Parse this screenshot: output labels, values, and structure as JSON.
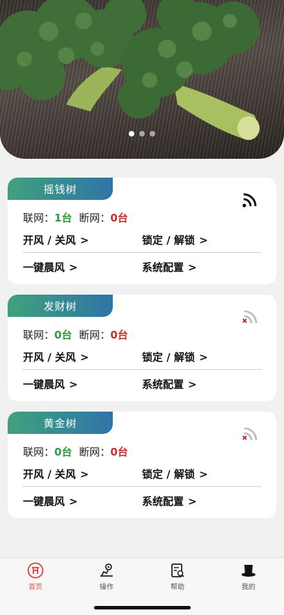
{
  "banner": {
    "image": "broccoli-photo",
    "slides": 3,
    "active_slide": 0
  },
  "devices": [
    {
      "name": "摇钱树",
      "connected": true,
      "online_label": "联网：",
      "online_count": "1台",
      "offline_label": "断网：",
      "offline_count": "0台",
      "actions": [
        "开风 / 关风",
        "锁定 / 解锁",
        "一键晨风",
        "系统配置"
      ]
    },
    {
      "name": "发财树",
      "connected": false,
      "online_label": "联网：",
      "online_count": "0台",
      "offline_label": "断网：",
      "offline_count": "0台",
      "actions": [
        "开风 / 关风",
        "锁定 / 解锁",
        "一键晨风",
        "系统配置"
      ]
    },
    {
      "name": "黄金树",
      "connected": false,
      "online_label": "联网：",
      "online_count": "0台",
      "offline_label": "断网：",
      "offline_count": "0台",
      "actions": [
        "开风 / 关风",
        "锁定 / 解锁",
        "一键晨风",
        "系统配置"
      ]
    }
  ],
  "chevron": ">",
  "tabbar": {
    "tabs": [
      {
        "label": "首页",
        "icon": "home-icon",
        "active": true
      },
      {
        "label": "操作",
        "icon": "operation-icon",
        "active": false
      },
      {
        "label": "帮助",
        "icon": "help-icon",
        "active": false
      },
      {
        "label": "我的",
        "icon": "profile-icon",
        "active": false
      }
    ]
  },
  "colors": {
    "title_gradient_start": "#3fa27b",
    "title_gradient_end": "#2f74a8",
    "online": "#2f9a3e",
    "offline": "#c9302c",
    "active_tab": "#d9534f"
  }
}
